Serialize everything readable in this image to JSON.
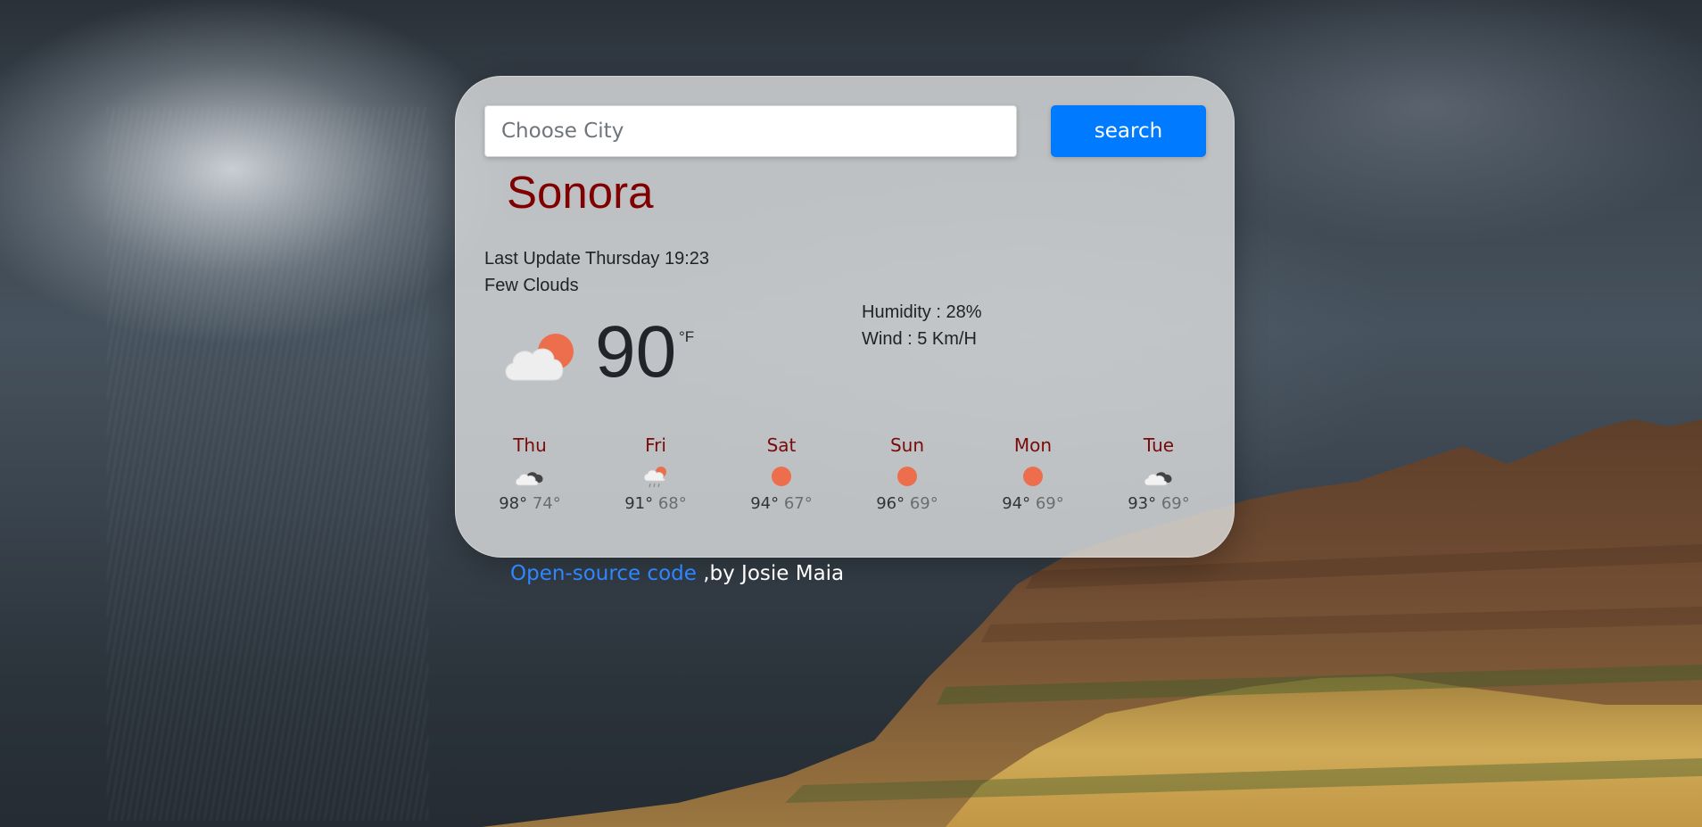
{
  "search": {
    "placeholder": "Choose City",
    "button_label": "search"
  },
  "current": {
    "city": "Sonora",
    "last_update": "Last Update Thursday 19:23",
    "description": "Few Clouds",
    "temperature": "90",
    "unit": "°F",
    "humidity": "Humidity : 28%",
    "wind": "Wind : 5 Km/H",
    "icon": "few-clouds-day-icon"
  },
  "forecast": [
    {
      "day": "Thu",
      "max": "98°",
      "min": "74°",
      "icon": "broken-clouds-icon"
    },
    {
      "day": "Fri",
      "max": "91°",
      "min": "68°",
      "icon": "light-rain-icon"
    },
    {
      "day": "Sat",
      "max": "94°",
      "min": "67°",
      "icon": "clear-sky-icon"
    },
    {
      "day": "Sun",
      "max": "96°",
      "min": "69°",
      "icon": "clear-sky-icon"
    },
    {
      "day": "Mon",
      "max": "94°",
      "min": "69°",
      "icon": "clear-sky-icon"
    },
    {
      "day": "Tue",
      "max": "93°",
      "min": "69°",
      "icon": "broken-clouds-icon"
    }
  ],
  "footer": {
    "link_text": "Open-source code",
    "byline": " ,by Josie Maia"
  },
  "colors": {
    "city": "#800000",
    "button": "#007bff",
    "link": "#2f86ff",
    "sun": "#ec6e4c",
    "forecast_day": "#7a0a0a"
  }
}
